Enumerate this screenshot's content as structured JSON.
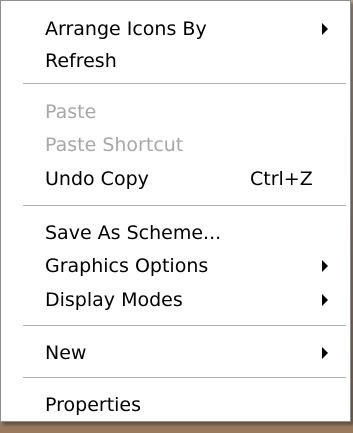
{
  "context_menu": {
    "groups": [
      [
        {
          "label": "Arrange Icons By",
          "submenu_icon": "chevron-right-icon"
        },
        {
          "label": "Refresh"
        }
      ],
      [
        {
          "label": "Paste",
          "disabled": true
        },
        {
          "label": "Paste Shortcut",
          "disabled": true
        },
        {
          "label": "Undo Copy",
          "shortcut": "Ctrl+Z"
        }
      ],
      [
        {
          "label": "Save As Scheme..."
        },
        {
          "label": "Graphics Options",
          "submenu_icon": "chevron-right-icon"
        },
        {
          "label": "Display Modes",
          "submenu_icon": "chevron-right-icon"
        }
      ],
      [
        {
          "label": "New",
          "submenu_icon": "chevron-right-icon"
        }
      ],
      [
        {
          "label": "Properties"
        }
      ]
    ],
    "colors": {
      "background": "#ffffff",
      "text": "#000000",
      "disabled_text": "#a7a7a7",
      "separator": "#b2b2b2",
      "border": "#8e8e8e"
    }
  }
}
